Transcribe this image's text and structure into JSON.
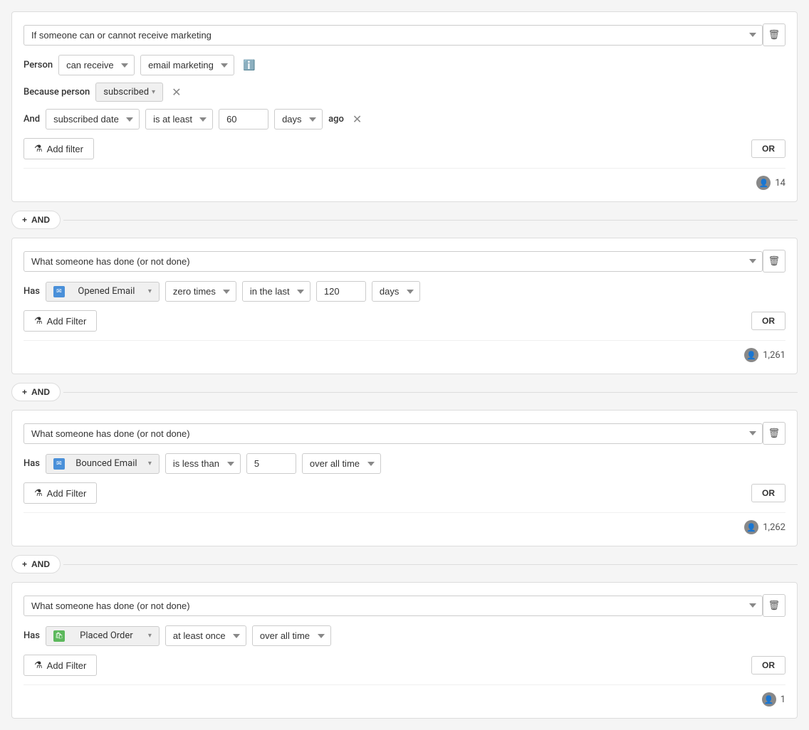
{
  "blocks": [
    {
      "id": "block1",
      "main_dropdown_label": "If someone can or cannot receive marketing",
      "person_label": "Person",
      "can_receive_label": "can receive",
      "email_marketing_label": "email marketing",
      "because_person_label": "Because person",
      "subscribed_label": "subscribed",
      "and_label": "And",
      "subscribed_date_label": "subscribed date",
      "is_at_least_label": "is at least",
      "days_value": "60",
      "days_unit_label": "days",
      "ago_label": "ago",
      "add_filter_label": "Add filter",
      "or_label": "OR",
      "person_count": "14"
    },
    {
      "id": "block2",
      "main_dropdown_label": "What someone has done (or not done)",
      "has_label": "Has",
      "event_label": "Opened Email",
      "event_icon_type": "email",
      "frequency_label": "zero times",
      "time_range_label": "in the last",
      "time_value": "120",
      "time_unit_label": "days",
      "add_filter_label": "Add Filter",
      "or_label": "OR",
      "person_count": "1,261"
    },
    {
      "id": "block3",
      "main_dropdown_label": "What someone has done (or not done)",
      "has_label": "Has",
      "event_label": "Bounced Email",
      "event_icon_type": "email",
      "frequency_label": "is less than",
      "time_value": "5",
      "time_range_label": "over all time",
      "add_filter_label": "Add Filter",
      "or_label": "OR",
      "person_count": "1,262"
    },
    {
      "id": "block4",
      "main_dropdown_label": "What someone has done (or not done)",
      "has_label": "Has",
      "event_label": "Placed Order",
      "event_icon_type": "order",
      "frequency_label": "at least once",
      "time_range_label": "over all time",
      "add_filter_label": "Add Filter",
      "or_label": "OR",
      "person_count": "1"
    }
  ],
  "and_connector_label": "+ AND",
  "icons": {
    "trash": "🗑",
    "filter": "⚗",
    "info": "ℹ",
    "close": "✕",
    "person": "👤",
    "email_letter": "✉",
    "shopify": "🛍"
  }
}
